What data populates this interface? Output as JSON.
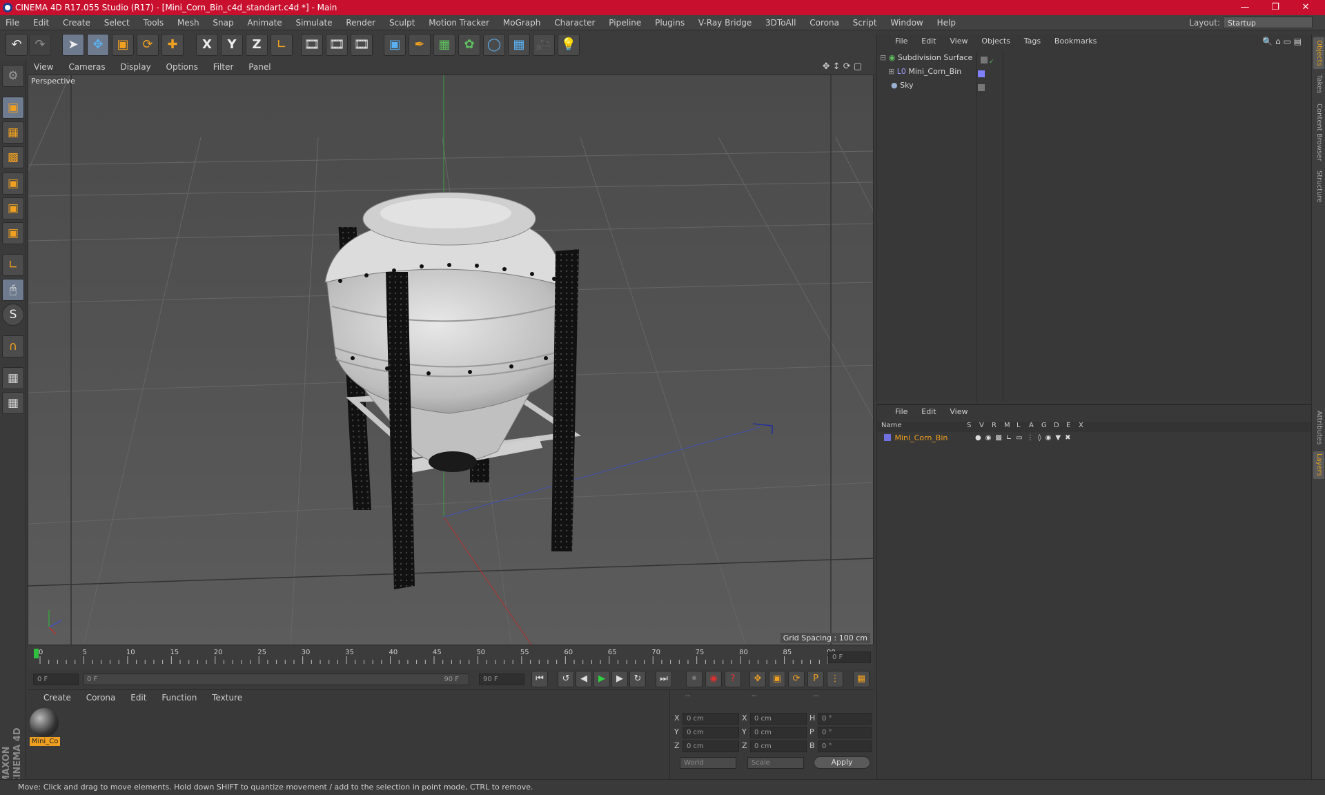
{
  "window": {
    "title": "CINEMA 4D R17.055 Studio (R17) - [Mini_Corn_Bin_c4d_standart.c4d *] - Main",
    "minimize_icon": "minimize-icon",
    "maximize_icon": "restore-icon",
    "close_icon": "close-icon"
  },
  "menubar": {
    "items": [
      "File",
      "Edit",
      "Create",
      "Select",
      "Tools",
      "Mesh",
      "Snap",
      "Animate",
      "Simulate",
      "Render",
      "Sculpt",
      "Motion Tracker",
      "MoGraph",
      "Character",
      "Pipeline",
      "Plugins",
      "V-Ray Bridge",
      "3DToAll",
      "Corona",
      "Script",
      "Window",
      "Help"
    ],
    "layout_label": "Layout:",
    "layout_value": "Startup"
  },
  "toolbar": {
    "axis_x": "X",
    "axis_y": "Y",
    "axis_z": "Z"
  },
  "viewport": {
    "menu": [
      "View",
      "Cameras",
      "Display",
      "Options",
      "Filter",
      "Panel"
    ],
    "name": "Perspective",
    "grid_spacing": "Grid Spacing : 100 cm"
  },
  "timeline": {
    "ticks": [
      "0",
      "5",
      "10",
      "15",
      "20",
      "25",
      "30",
      "35",
      "40",
      "45",
      "50",
      "55",
      "60",
      "65",
      "70",
      "75",
      "80",
      "85",
      "90"
    ],
    "current_frame": "0 F",
    "start_field": "0 F",
    "range_start": "0 F",
    "range_end": "90 F",
    "end_field": "90 F"
  },
  "materials": {
    "menu": [
      "Create",
      "Corona",
      "Edit",
      "Function",
      "Texture"
    ],
    "items": [
      {
        "label": "Mini_Co"
      }
    ]
  },
  "coords": {
    "header": [
      "--",
      "--",
      "--"
    ],
    "rows": [
      {
        "a": "X",
        "av": "0 cm",
        "b": "X",
        "bv": "0 cm",
        "c": "H",
        "cv": "0 °"
      },
      {
        "a": "Y",
        "av": "0 cm",
        "b": "Y",
        "bv": "0 cm",
        "c": "P",
        "cv": "0 °"
      },
      {
        "a": "Z",
        "av": "0 cm",
        "b": "Z",
        "bv": "0 cm",
        "c": "B",
        "cv": "0 °"
      }
    ],
    "mode1": "World",
    "mode2": "Scale",
    "apply": "Apply"
  },
  "object_manager": {
    "menu": [
      "File",
      "Edit",
      "View",
      "Objects",
      "Tags",
      "Bookmarks"
    ],
    "objects": [
      {
        "name": "Subdivision Surface",
        "icon": "subdivision-icon",
        "color": "#5fc05f"
      },
      {
        "name": "Mini_Corn_Bin",
        "icon": "null-icon",
        "color": "#a0a0ff"
      },
      {
        "name": "Sky",
        "icon": "sky-icon",
        "color": "#9ab0d0"
      }
    ]
  },
  "layer_manager": {
    "menu": [
      "File",
      "Edit",
      "View"
    ],
    "columns": [
      "Name",
      "S",
      "V",
      "R",
      "M",
      "L",
      "A",
      "G",
      "D",
      "E",
      "X"
    ],
    "layers": [
      {
        "name": "Mini_Corn_Bin",
        "color": "#7070e0"
      }
    ]
  },
  "right_tabs": [
    "Objects",
    "Takes",
    "Content Browser",
    "Structure",
    "Attributes",
    "Layers"
  ],
  "status": "Move: Click and drag to move elements. Hold down SHIFT to quantize movement / add to the selection in point mode, CTRL to remove.",
  "brand": "MAXON CINEMA 4D"
}
